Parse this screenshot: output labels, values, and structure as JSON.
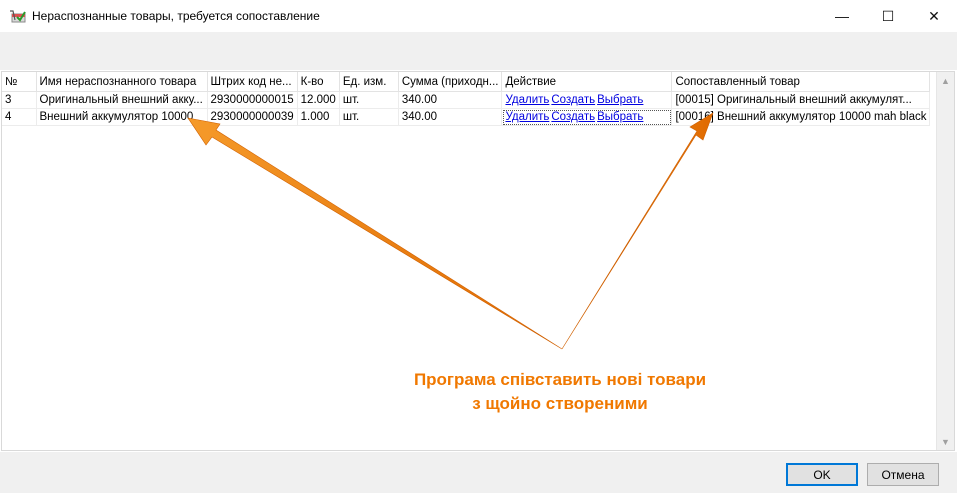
{
  "window": {
    "title": "Нераспознанные товары, требуется сопоставление",
    "icon": "cart-icon",
    "controls": {
      "minimize": "—",
      "maximize": "☐",
      "close": "✕"
    }
  },
  "table": {
    "columns": [
      "№",
      "Имя нераспознанного товара",
      "Штрих код не...",
      "К-во",
      "Ед. изм.",
      "Сумма (приходн...",
      "Действие",
      "Сопоставленный товар"
    ],
    "rows": [
      {
        "num": "3",
        "name": "Оригинальный внешний акку...",
        "barcode": "2930000000015",
        "qty": "12.000",
        "unit": "шт.",
        "sum": "340.00",
        "actions": [
          "Удалить",
          "Создать",
          "Выбрать"
        ],
        "matched": "[00015] Оригинальный внешний аккумулят..."
      },
      {
        "num": "4",
        "name": "Внешний аккумулятор 10000",
        "barcode": "2930000000039",
        "qty": "1.000",
        "unit": "шт.",
        "sum": "340.00",
        "actions": [
          "Удалить",
          "Создать",
          "Выбрать"
        ],
        "matched": "[00016] Внешний аккумулятор 10000 mah black"
      }
    ]
  },
  "annotation": {
    "line1": "Програма співставить нові товари",
    "line2": "з щойно створеними",
    "color": "#f07800"
  },
  "buttons": {
    "ok": "OK",
    "cancel": "Отмена"
  },
  "scrollbar": {
    "up": "▲",
    "down": "▼"
  }
}
